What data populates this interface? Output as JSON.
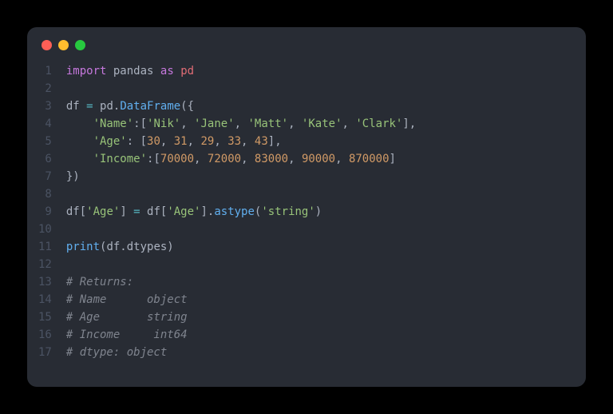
{
  "window": {
    "traffic_lights": [
      "red",
      "yellow",
      "green"
    ]
  },
  "code": {
    "line_count": 17,
    "line1": {
      "import": "import",
      "module": "pandas",
      "as": "as",
      "alias": "pd"
    },
    "line3": {
      "var": "df",
      "eq": " = ",
      "obj": "pd",
      "dot": ".",
      "fn": "DataFrame",
      "open": "({"
    },
    "line4": {
      "indent": "    ",
      "key": "'Name'",
      "colon": ":",
      "lb": "[",
      "v1": "'Nik'",
      "c1": ", ",
      "v2": "'Jane'",
      "c2": ", ",
      "v3": "'Matt'",
      "c3": ", ",
      "v4": "'Kate'",
      "c4": ", ",
      "v5": "'Clark'",
      "rb": "],"
    },
    "line5": {
      "indent": "    ",
      "key": "'Age'",
      "colon": ": ",
      "lb": "[",
      "v1": "30",
      "c1": ", ",
      "v2": "31",
      "c2": ", ",
      "v3": "29",
      "c3": ", ",
      "v4": "33",
      "c4": ", ",
      "v5": "43",
      "rb": "],"
    },
    "line6": {
      "indent": "    ",
      "key": "'Income'",
      "colon": ":",
      "lb": "[",
      "v1": "70000",
      "c1": ", ",
      "v2": "72000",
      "c2": ", ",
      "v3": "83000",
      "c3": ", ",
      "v4": "90000",
      "c4": ", ",
      "v5": "870000",
      "rb": "]"
    },
    "line7": {
      "close": "})"
    },
    "line9": {
      "p1": "df[",
      "s1": "'Age'",
      "p2": "] ",
      "eq": "=",
      "p3": " df[",
      "s2": "'Age'",
      "p4": "].",
      "fn": "astype",
      "p5": "(",
      "s3": "'string'",
      "p6": ")"
    },
    "line11": {
      "fn": "print",
      "p1": "(df.dtypes)"
    },
    "line13": "# Returns:",
    "line14": "# Name      object",
    "line15": "# Age       string",
    "line16": "# Income     int64",
    "line17": "# dtype: object"
  }
}
